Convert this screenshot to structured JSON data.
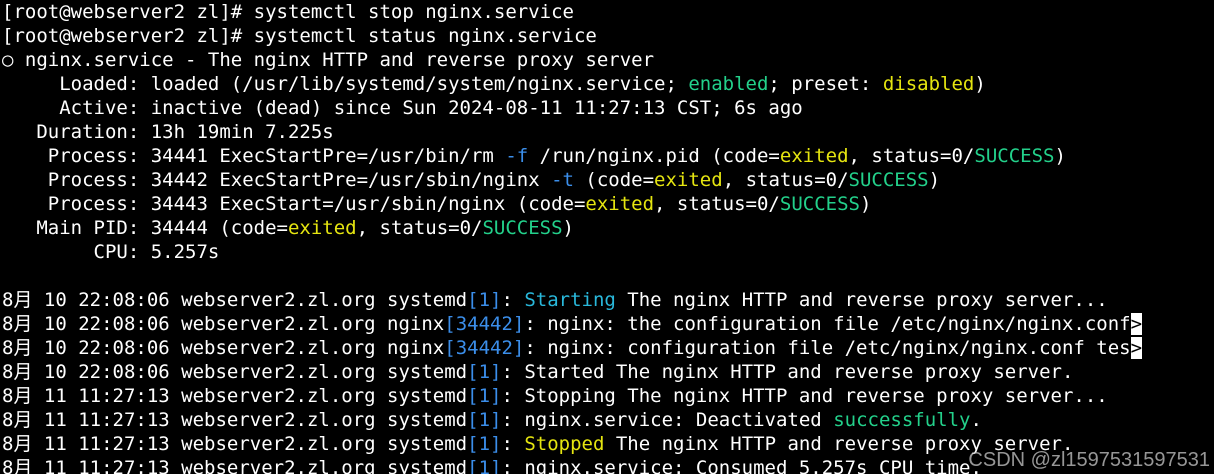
{
  "colors": {
    "background": "#000000",
    "text": "#ffffff",
    "yellow": "#e5e510",
    "green": "#23d18b",
    "cyan": "#29b8db",
    "blue": "#3b8eea"
  },
  "lines": [
    [
      {
        "t": "[root@webserver2 zl]# systemctl stop nginx.service"
      }
    ],
    [
      {
        "t": "[root@webserver2 zl]# systemctl status nginx.service"
      }
    ],
    [
      {
        "t": "○ nginx.service - The nginx HTTP and reverse proxy server"
      }
    ],
    [
      {
        "t": "     Loaded: loaded (/usr/lib/systemd/system/nginx.service; "
      },
      {
        "t": "enabled",
        "c": "g"
      },
      {
        "t": "; preset: "
      },
      {
        "t": "disabled",
        "c": "y"
      },
      {
        "t": ")"
      }
    ],
    [
      {
        "t": "     Active: inactive (dead) since Sun 2024-08-11 11:27:13 CST; 6s ago"
      }
    ],
    [
      {
        "t": "   Duration: 13h 19min 7.225s"
      }
    ],
    [
      {
        "t": "    Process: 34441 ExecStartPre=/usr/bin/rm "
      },
      {
        "t": "-f",
        "c": "b"
      },
      {
        "t": " /run/nginx.pid (code="
      },
      {
        "t": "exited",
        "c": "y"
      },
      {
        "t": ", status=0/"
      },
      {
        "t": "SUCCESS",
        "c": "g"
      },
      {
        "t": ")"
      }
    ],
    [
      {
        "t": "    Process: 34442 ExecStartPre=/usr/sbin/nginx "
      },
      {
        "t": "-t",
        "c": "b"
      },
      {
        "t": " (code="
      },
      {
        "t": "exited",
        "c": "y"
      },
      {
        "t": ", status=0/"
      },
      {
        "t": "SUCCESS",
        "c": "g"
      },
      {
        "t": ")"
      }
    ],
    [
      {
        "t": "    Process: 34443 ExecStart=/usr/sbin/nginx (code="
      },
      {
        "t": "exited",
        "c": "y"
      },
      {
        "t": ", status=0/"
      },
      {
        "t": "SUCCESS",
        "c": "g"
      },
      {
        "t": ")"
      }
    ],
    [
      {
        "t": "   Main PID: 34444 (code="
      },
      {
        "t": "exited",
        "c": "y"
      },
      {
        "t": ", status=0/"
      },
      {
        "t": "SUCCESS",
        "c": "g"
      },
      {
        "t": ")"
      }
    ],
    [
      {
        "t": "        CPU: 5.257s"
      }
    ],
    [
      {
        "t": ""
      }
    ],
    [
      {
        "t": "8月 10 22:08:06 webserver2.zl.org systemd"
      },
      {
        "t": "[1]",
        "c": "b"
      },
      {
        "t": ": "
      },
      {
        "t": "Starting",
        "c": "c"
      },
      {
        "t": " The nginx HTTP and reverse proxy server..."
      }
    ],
    [
      {
        "t": "8月 10 22:08:06 webserver2.zl.org nginx"
      },
      {
        "t": "[34442]",
        "c": "b"
      },
      {
        "t": ": nginx: the configuration file /etc/nginx/nginx.conf"
      },
      {
        "t": ">",
        "c": "cursor-mark"
      }
    ],
    [
      {
        "t": "8月 10 22:08:06 webserver2.zl.org nginx"
      },
      {
        "t": "[34442]",
        "c": "b"
      },
      {
        "t": ": nginx: configuration file /etc/nginx/nginx.conf tes"
      },
      {
        "t": ">",
        "c": "cursor-mark"
      }
    ],
    [
      {
        "t": "8月 10 22:08:06 webserver2.zl.org systemd"
      },
      {
        "t": "[1]",
        "c": "b"
      },
      {
        "t": ": Started The nginx HTTP and reverse proxy server."
      }
    ],
    [
      {
        "t": "8月 11 11:27:13 webserver2.zl.org systemd"
      },
      {
        "t": "[1]",
        "c": "b"
      },
      {
        "t": ": Stopping The nginx HTTP and reverse proxy server..."
      }
    ],
    [
      {
        "t": "8月 11 11:27:13 webserver2.zl.org systemd"
      },
      {
        "t": "[1]",
        "c": "b"
      },
      {
        "t": ": nginx.service: Deactivated "
      },
      {
        "t": "successfully",
        "c": "g"
      },
      {
        "t": "."
      }
    ],
    [
      {
        "t": "8月 11 11:27:13 webserver2.zl.org systemd"
      },
      {
        "t": "[1]",
        "c": "b"
      },
      {
        "t": ": "
      },
      {
        "t": "Stopped",
        "c": "y"
      },
      {
        "t": " The nginx HTTP and reverse proxy server."
      }
    ],
    [
      {
        "t": "8月 11 11:27:13 webserver2.zl.org systemd"
      },
      {
        "t": "[1]",
        "c": "b"
      },
      {
        "t": ": nginx.service: Consumed 5.257s CPU time."
      }
    ]
  ],
  "watermark": "CSDN @zl1597531597531"
}
